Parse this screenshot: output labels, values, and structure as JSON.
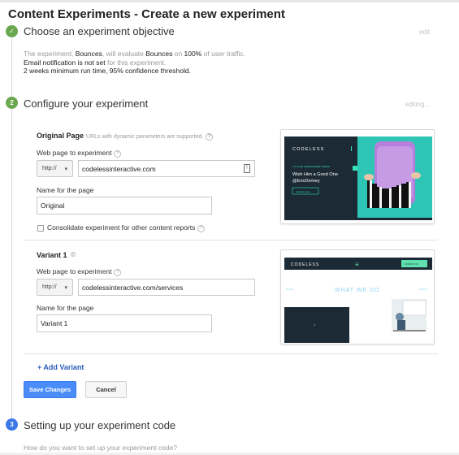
{
  "page": {
    "title": "Content Experiments - Create a new experiment"
  },
  "steps": {
    "step1": {
      "badge": "✓",
      "title": "Choose an experiment objective",
      "action": "edit",
      "summary": {
        "p1": "The experiment, ",
        "metric1": "Bounces",
        "p2": ", will evaluate ",
        "metric2": "Bounces",
        "p3": " on ",
        "traffic": "100%",
        "p4": " of user traffic.",
        "email_a": "Email notification is not set",
        "email_b": " for this experiment.",
        "line3": "2 weeks minimum run time, 95% confidence threshold."
      }
    },
    "step2": {
      "badge": "2",
      "title": "Configure your experiment",
      "status": "editing..."
    },
    "step3": {
      "badge": "3",
      "title": "Setting up your experiment code",
      "question": "How do you want to set up your experiment code?"
    }
  },
  "original": {
    "heading": "Original Page",
    "note": "URLs with dynamic parameters are supported.",
    "url_label": "Web page to experiment",
    "protocol": "http://",
    "url": "codelessinteractive.com",
    "name_label": "Name for the page",
    "name": "Original",
    "consolidate": "Consolidate experiment for other content reports",
    "thumb": {
      "logo": "CODELESS",
      "small_caps": "IT'S GOOD & RESPONSIBLE THINGS!",
      "headline1": "Wish Him a Good One",
      "headline2": "@EricDiviney",
      "cta": "Explore more",
      "colors": {
        "dark": "#1b2a35",
        "accent": "#36e1b9",
        "bg2": "#20b5a6",
        "case": "#b77fdb"
      }
    }
  },
  "variant": {
    "heading": "Variant 1",
    "url_label": "Web page to experiment",
    "protocol": "http://",
    "url": "codelessinteractive.com/services",
    "name_label": "Name for the page",
    "name": "Variant 1",
    "thumb": {
      "logo": "CODELESS",
      "contact": "CONTACT US",
      "heading": "WHAT WE DO",
      "left_text": "DIGITAL",
      "right_text": "DESIGN",
      "colors": {
        "dark": "#1b2a35",
        "accent": "#5fe0ae",
        "heading": "#8fd5f5"
      }
    }
  },
  "buttons": {
    "add_variant": "+ Add Variant",
    "save": "Save Changes",
    "cancel": "Cancel"
  },
  "icons": {
    "help": "?",
    "contact_card": "≡",
    "dropdown": "▾",
    "info": "©"
  }
}
